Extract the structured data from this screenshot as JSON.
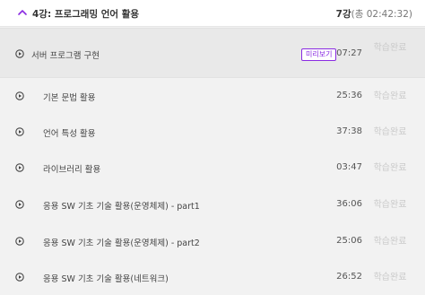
{
  "section": {
    "title": "4강: 프로그래밍 언어 활용",
    "lesson_count": "7강",
    "total_time": "(총 02:42:32)",
    "icon": "chevron-up-icon"
  },
  "lessons": [
    {
      "title": "서버 프로그램 구현",
      "badge": "미리보기",
      "duration": "07:27",
      "status": "학습완료"
    },
    {
      "title": "기본 문법 활용",
      "duration": "25:36",
      "status": "학습완료"
    },
    {
      "title": "언어 특성 활용",
      "duration": "37:38",
      "status": "학습완료"
    },
    {
      "title": "라이브러리 활용",
      "duration": "03:47",
      "status": "학습완료"
    },
    {
      "title": "응용 SW 기초 기술 활용(운영체제) - part1",
      "duration": "36:06",
      "status": "학습완료"
    },
    {
      "title": "응용 SW 기초 기술 활용(운영체제) - part2",
      "duration": "25:06",
      "status": "학습완료"
    },
    {
      "title": "응용 SW 기초 기술 활용(네트워크)",
      "duration": "26:52",
      "status": "학습완료"
    }
  ],
  "colors": {
    "accent": "#8a2be2",
    "status_done": "#cacaca"
  }
}
